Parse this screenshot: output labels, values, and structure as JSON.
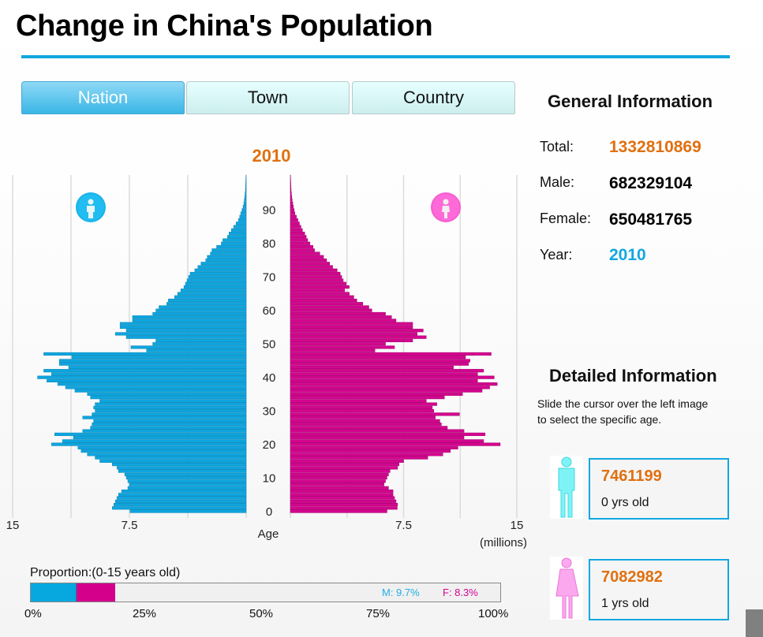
{
  "page": {
    "title": "Change in China's Population"
  },
  "tabs": [
    {
      "label": "Nation",
      "active": true
    },
    {
      "label": "Town",
      "active": false
    },
    {
      "label": "Country",
      "active": false
    }
  ],
  "colors": {
    "male": "#0ea5de",
    "female": "#d4058f",
    "accent_orange": "#e07010",
    "accent_blue": "#11a6dc"
  },
  "icons": {
    "male_badge": "male-person-icon",
    "female_badge": "female-person-icon",
    "male_figure": "male-figure-icon",
    "female_figure": "female-figure-icon"
  },
  "general": {
    "heading": "General Information",
    "total_label": "Total:",
    "total_value": "1332810869",
    "male_label": "Male:",
    "male_value": "682329104",
    "female_label": "Female:",
    "female_value": "650481765",
    "year_label": "Year:",
    "year_value": "2010"
  },
  "detailed": {
    "heading": "Detailed Information",
    "hint_line1": "Slide the cursor over the left image",
    "hint_line2": "to select the specific age.",
    "male_card": {
      "value": "7461199",
      "age_text": "0 yrs old"
    },
    "female_card": {
      "value": "7082982",
      "age_text": "1 yrs old"
    }
  },
  "proportion": {
    "label": "Proportion:(0-15 years old)",
    "male_percent": 9.7,
    "female_percent": 8.3,
    "male_text": "M:  9.7%",
    "female_text": "F:  8.3%",
    "ticks": [
      "0%",
      "25%",
      "50%",
      "75%",
      "100%"
    ]
  },
  "chart_data": {
    "type": "bar",
    "subtype": "population-pyramid",
    "title": "2010",
    "xlabel": "(millions)",
    "ylabel": "Age",
    "x_ticks_left": [
      "15",
      "7.5"
    ],
    "x_ticks_right": [
      "7.5",
      "15"
    ],
    "xlim": [
      0,
      15
    ],
    "age_ticks": [
      "0",
      "10",
      "20",
      "30",
      "40",
      "50",
      "60",
      "70",
      "80",
      "90"
    ],
    "ages": [
      0,
      1,
      2,
      3,
      4,
      5,
      6,
      7,
      8,
      9,
      10,
      11,
      12,
      13,
      14,
      15,
      16,
      17,
      18,
      19,
      20,
      21,
      22,
      23,
      24,
      25,
      26,
      27,
      28,
      29,
      30,
      31,
      32,
      33,
      34,
      35,
      36,
      37,
      38,
      39,
      40,
      41,
      42,
      43,
      44,
      45,
      46,
      47,
      48,
      49,
      50,
      51,
      52,
      53,
      54,
      55,
      56,
      57,
      58,
      59,
      60,
      61,
      62,
      63,
      64,
      65,
      66,
      67,
      68,
      69,
      70,
      71,
      72,
      73,
      74,
      75,
      76,
      77,
      78,
      79,
      80,
      81,
      82,
      83,
      84,
      85,
      86,
      87,
      88,
      89,
      90,
      91,
      92,
      93,
      94,
      95,
      96,
      97,
      98,
      99,
      100
    ],
    "series": [
      {
        "name": "Male",
        "values": [
          7.46,
          8.6,
          8.5,
          8.4,
          8.3,
          8.2,
          8.0,
          7.6,
          7.5,
          7.6,
          7.7,
          7.8,
          8.2,
          8.3,
          8.6,
          9.4,
          9.7,
          10.2,
          10.6,
          10.8,
          12.5,
          11.8,
          11.1,
          12.3,
          10.5,
          10.0,
          9.9,
          9.8,
          10.5,
          9.9,
          9.7,
          9.8,
          9.7,
          9.4,
          10.0,
          10.2,
          11.0,
          11.6,
          12.1,
          12.8,
          13.4,
          12.5,
          13.0,
          11.4,
          12.0,
          12.0,
          11.2,
          13.0,
          6.4,
          7.4,
          6.0,
          5.8,
          7.7,
          8.4,
          7.7,
          8.1,
          8.1,
          7.3,
          7.3,
          6.0,
          5.8,
          5.6,
          5.1,
          5.0,
          4.6,
          4.4,
          4.2,
          4.0,
          3.9,
          3.8,
          3.7,
          3.6,
          3.3,
          3.1,
          2.9,
          2.6,
          2.5,
          2.3,
          2.2,
          1.9,
          1.6,
          1.5,
          1.2,
          1.1,
          0.95,
          0.8,
          0.65,
          0.5,
          0.42,
          0.35,
          0.27,
          0.2,
          0.15,
          0.12,
          0.09,
          0.07,
          0.05,
          0.04,
          0.03,
          0.02,
          0.01
        ],
        "color": "#0ea5de"
      },
      {
        "name": "Female",
        "values": [
          6.4,
          7.08,
          7.1,
          7.0,
          6.9,
          6.8,
          6.8,
          6.5,
          6.2,
          6.3,
          6.4,
          6.5,
          6.6,
          7.1,
          7.2,
          7.5,
          9.1,
          10.1,
          10.6,
          11.1,
          13.9,
          12.8,
          11.5,
          12.9,
          11.5,
          10.4,
          10.0,
          9.9,
          9.6,
          11.2,
          9.5,
          9.4,
          9.7,
          9.0,
          10.2,
          11.4,
          12.7,
          13.2,
          13.7,
          12.4,
          13.5,
          12.4,
          12.8,
          10.8,
          11.8,
          11.9,
          11.6,
          13.3,
          5.6,
          6.9,
          6.3,
          8.1,
          9.0,
          8.4,
          8.8,
          8.1,
          8.1,
          7.0,
          6.7,
          6.3,
          5.4,
          5.2,
          4.8,
          4.4,
          4.2,
          3.9,
          3.6,
          3.9,
          3.7,
          3.5,
          3.4,
          3.3,
          3.1,
          2.8,
          2.6,
          2.4,
          2.2,
          1.95,
          1.6,
          1.5,
          1.3,
          1.15,
          1.05,
          0.95,
          0.8,
          0.7,
          0.6,
          0.5,
          0.4,
          0.3,
          0.25,
          0.2,
          0.16,
          0.12,
          0.09,
          0.07,
          0.05,
          0.04,
          0.03,
          0.02,
          0.01
        ],
        "color": "#d4058f"
      }
    ],
    "grid": true
  }
}
